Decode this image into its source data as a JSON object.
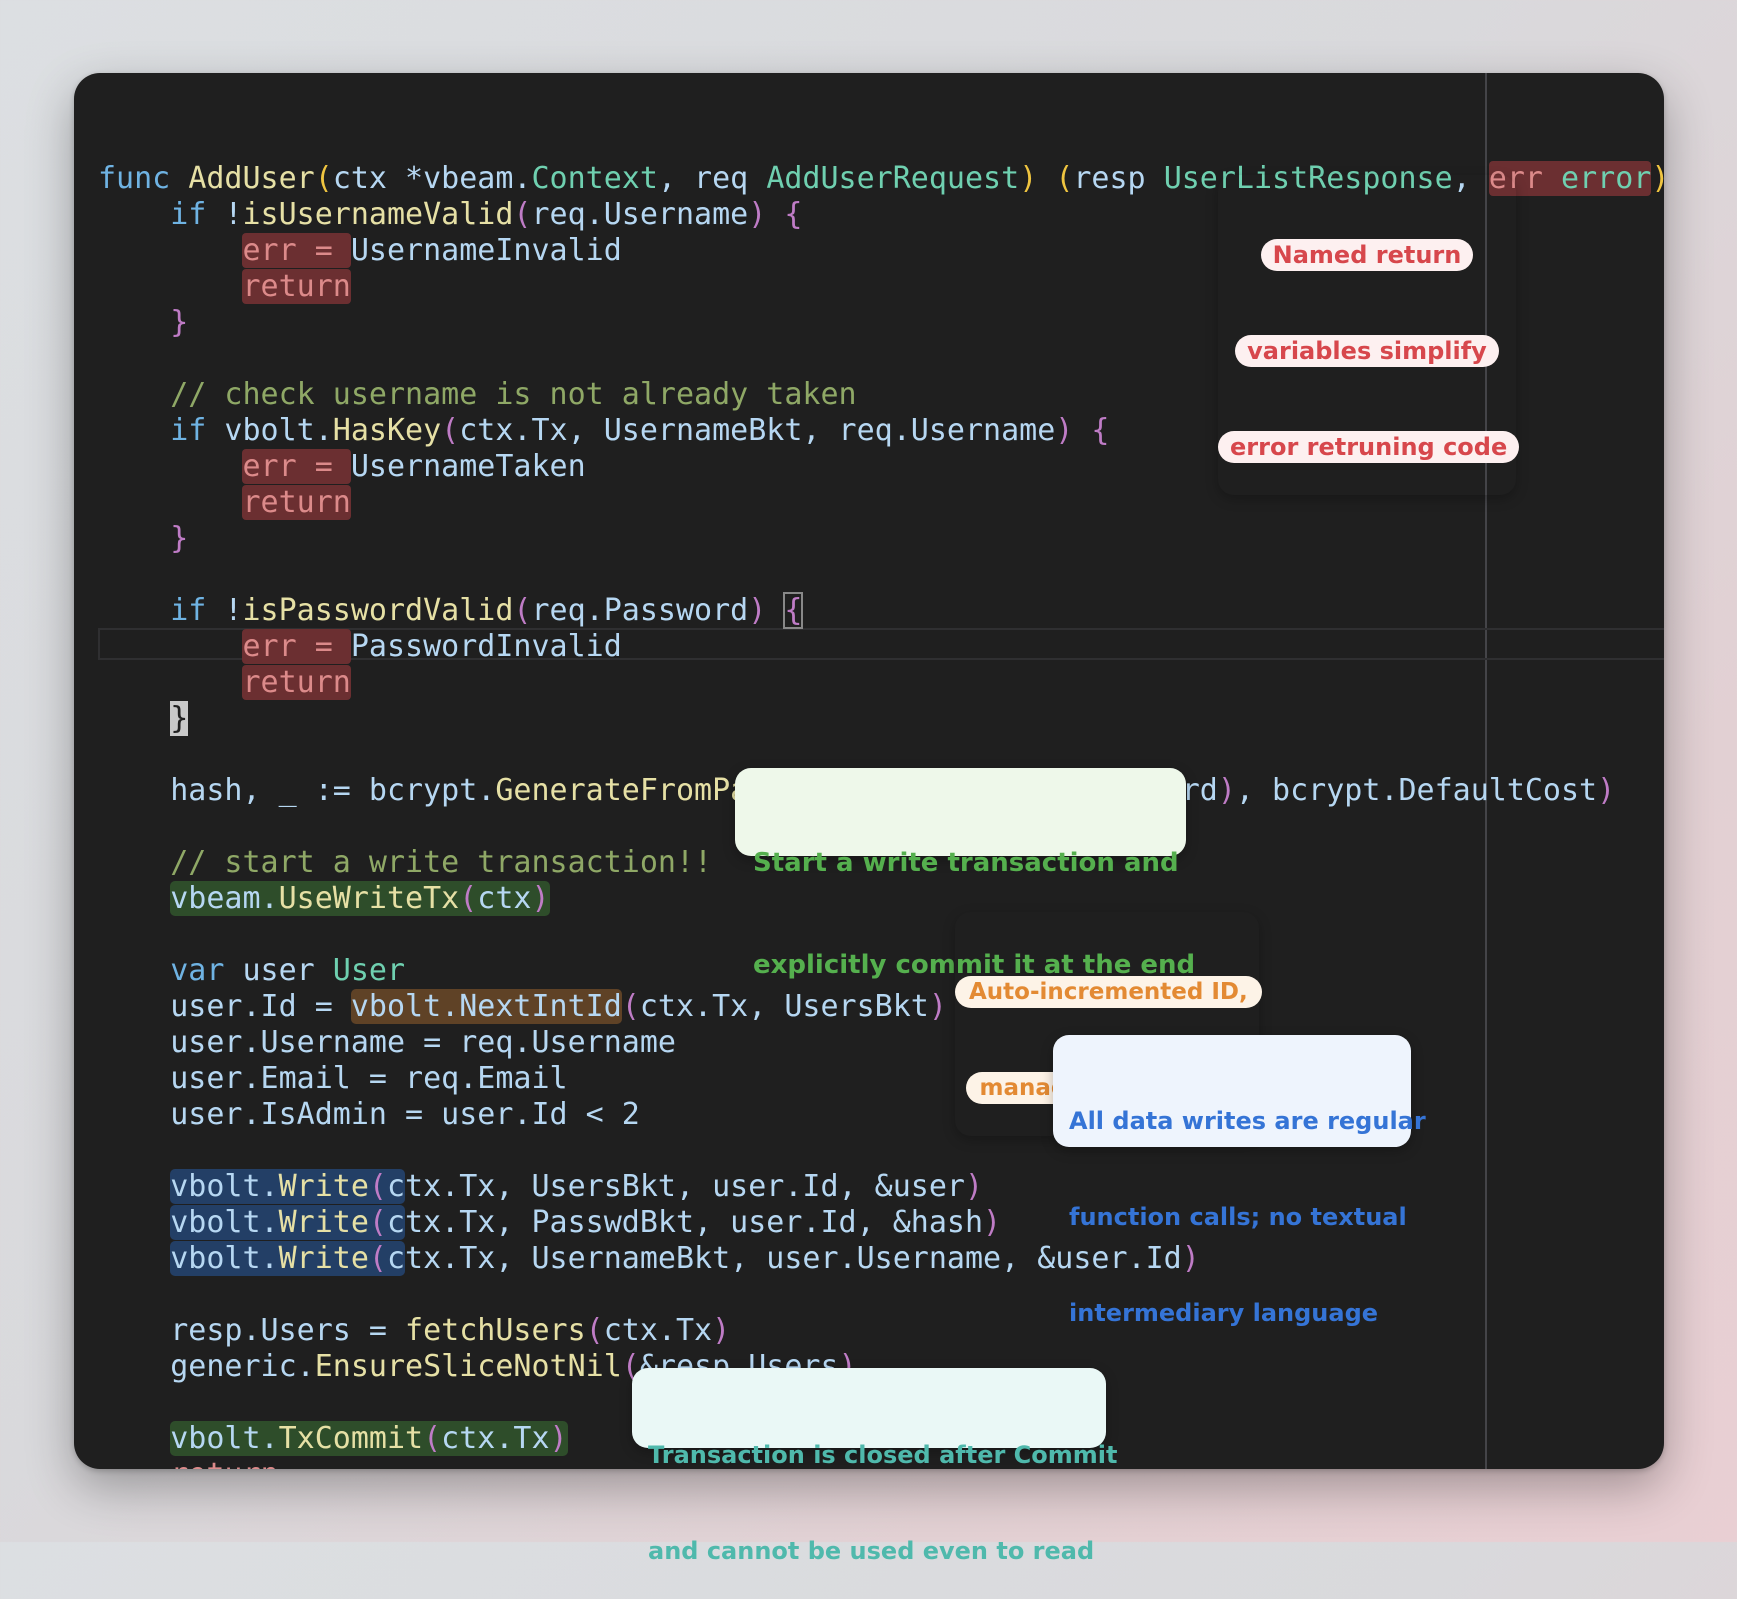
{
  "code_lines": [
    "func AddUser(ctx *vbeam.Context, req AddUserRequest) (resp UserListResponse, err error) {",
    "if !isUsernameValid(req.Username) {",
    "err = UsernameInvalid",
    "return",
    "}",
    "// check username is not already taken",
    "if vbolt.HasKey(ctx.Tx, UsernameBkt, req.Username) {",
    "err = UsernameTaken",
    "return",
    "}",
    "if !isPasswordValid(req.Password) {",
    "err = PasswordInvalid",
    "return",
    "}",
    "hash, _ := bcrypt.GenerateFromPassword([]byte(req.Password), bcrypt.DefaultCost)",
    "// start a write transaction!!",
    "vbeam.UseWriteTx(ctx)",
    "var user User",
    "user.Id = vbolt.NextIntId(ctx.Tx, UsersBkt)",
    "user.Username = req.Username",
    "user.Email = req.Email",
    "user.IsAdmin = user.Id < 2",
    "vbolt.Write(ctx.Tx, UsersBkt, user.Id, &user)",
    "vbolt.Write(ctx.Tx, PasswdBkt, user.Id, &hash)",
    "vbolt.Write(ctx.Tx, UsernameBkt, user.Username, &user.Id)",
    "resp.Users = fetchUsers(ctx.Tx)",
    "generic.EnsureSliceNotNil(&resp.Users)",
    "vbolt.TxCommit(ctx.Tx)",
    "return",
    "}"
  ],
  "annotations": {
    "named_return": [
      "Named return",
      "variables simplify",
      "error retruning code"
    ],
    "write_tx": [
      "Start a write transaction and",
      "explicitly commit it at the end"
    ],
    "auto_id": [
      "Auto-incremented ID,",
      "managed by the DB"
    ],
    "data_writes": [
      "All data writes are regular",
      "function calls; no textual",
      "intermediary language"
    ],
    "tx_closed": [
      "Transaction is closed after Commit",
      "and cannot be used even to read"
    ]
  },
  "colors": {
    "editor_bg": "#1f1f1f",
    "keyword": "#6fb3e3",
    "function": "#e6e0a5",
    "type": "#6fd0b0",
    "comment": "#8fa866",
    "highlight_red": "#6b2f31",
    "highlight_green": "#2e4d2a",
    "highlight_orange": "#5f4226",
    "highlight_blue": "#233f66"
  }
}
